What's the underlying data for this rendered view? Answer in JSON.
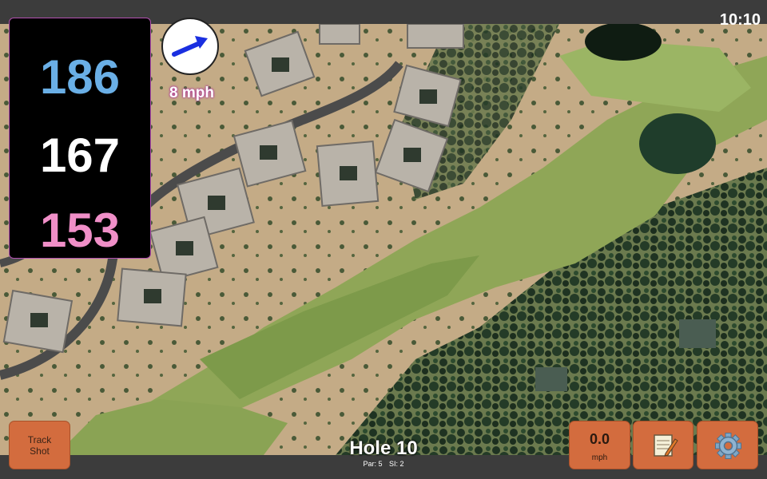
{
  "status": {
    "time": "10:10"
  },
  "distances": {
    "back": "186",
    "middle": "167",
    "front": "153"
  },
  "wind": {
    "speed_text": "8 mph",
    "direction_icon": "arrow-up-right-icon"
  },
  "hole": {
    "title": "Hole 10",
    "par": "Par: 5",
    "si": "SI: 2"
  },
  "buttons": {
    "track_shot": {
      "line1": "Track",
      "line2": "Shot"
    },
    "speed": {
      "value": "0.0",
      "unit": "mph"
    },
    "notes_icon": "notepad-icon",
    "settings_icon": "gear-icon"
  },
  "colors": {
    "back_distance": "#6aafe6",
    "middle_distance": "#ffffff",
    "front_distance": "#f08fc8",
    "button_bg": "#d36c3e",
    "wind_text_glow": "#b0309a"
  }
}
